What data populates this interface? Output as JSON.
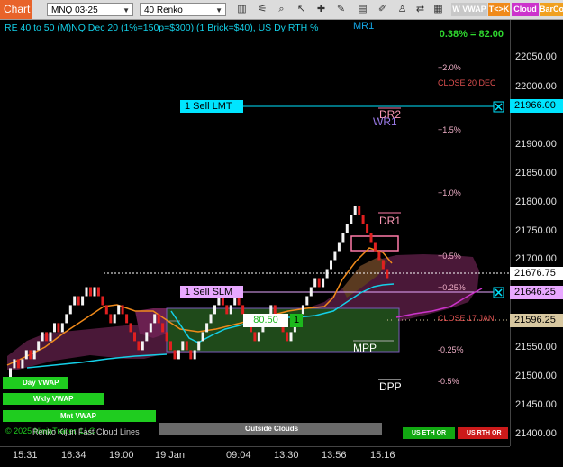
{
  "toolbar": {
    "tab": "Chart",
    "instrument": "MNQ 03-25",
    "bar_type": "40 Renko",
    "btn_wvwap": "W VWAP",
    "btn_tk": "T<>K",
    "btn_cloud": "Cloud",
    "btn_barco": "BarCo",
    "colors": {
      "tab": "#e8632a",
      "wvwap": "#c8c8c8",
      "tk": "#f08a1a",
      "cloud": "#cc33cc",
      "barco": "#f0a020"
    }
  },
  "chart_title": "RE 40 to 50 (M)NQ Dec 20 (1%=150p=$300) (1 Brick=$40), US Dy RTH %",
  "top_stat": "0.38% = 82.00",
  "level_labels": {
    "mr1": "MR1",
    "dr2": "DR2",
    "wr1": "WR1",
    "dr1": "DR1",
    "mpp": "MPP",
    "dpp": "DPP",
    "p2": "+2.0%",
    "close_dec": "CLOSE 20 DEC",
    "p15": "+1.5%",
    "p10": "+1.0%",
    "p05": "+0.5%",
    "p025": "+0.25%",
    "close_jan": "CLOSE 17 JAN",
    "m025": "-0.25%",
    "m05": "-0.5%"
  },
  "orders": {
    "sell_lmt": "1 Sell LMT",
    "sell_slm": "1 Sell SLM",
    "position_price": "80.50",
    "position_qty": "1"
  },
  "price_axis": {
    "ticks": [
      "22050.00",
      "22000.00",
      "21900.00",
      "21850.00",
      "21800.00",
      "21750.00",
      "21700.00",
      "21550.00",
      "21500.00",
      "21450.00",
      "21400.00"
    ],
    "tag_lmt": "21966.00",
    "tag_last": "21676.75",
    "tag_slm": "21646.25",
    "tag_close": "21596.25",
    "colors": {
      "lmt": "#00e5ff",
      "last": "#ffffff",
      "slm": "#e8a8ff",
      "close": "#d8c8a0"
    }
  },
  "time_axis": [
    "15:31",
    "16:34",
    "19:00",
    "19 Jan",
    "09:04",
    "13:30",
    "13:56",
    "15:16"
  ],
  "legend": {
    "day_vwap": "Day VWAP",
    "wkly_vwap": "Wkly VWAP",
    "mnt_vwap": "Mnt VWAP",
    "copyright": "© 2025 NinjaTrader, LLC",
    "renko": "Renko Kijun Fast Cloud Lines",
    "outside_clouds": "Outside Clouds",
    "us_eth": "US ETH OR",
    "us_rth": "US RTH OR"
  },
  "chart_data": {
    "type": "renko-candlestick",
    "title": "RE 40 to 50 (M)NQ Dec 20 (1%=150p=$300) (1 Brick=$40), US Dy RTH %",
    "ylim": [
      21380,
      22090
    ],
    "x_ticks": [
      "15:31",
      "16:34",
      "19:00",
      "19 Jan",
      "09:04",
      "13:30",
      "13:56",
      "15:16"
    ],
    "brick_closes": [
      21510,
      21525,
      21510,
      21525,
      21540,
      21525,
      21540,
      21555,
      21570,
      21555,
      21570,
      21585,
      21570,
      21585,
      21600,
      21615,
      21630,
      21615,
      21630,
      21645,
      21630,
      21645,
      21630,
      21615,
      21600,
      21585,
      21600,
      21615,
      21600,
      21585,
      21570,
      21555,
      21540,
      21555,
      21570,
      21585,
      21600,
      21585,
      21570,
      21555,
      21540,
      21525,
      21540,
      21555,
      21540,
      21525,
      21540,
      21555,
      21570,
      21585,
      21600,
      21615,
      21630,
      21615,
      21600,
      21615,
      21630,
      21615,
      21600,
      21585,
      21570,
      21555,
      21570,
      21585,
      21600,
      21615,
      21600,
      21585,
      21570,
      21555,
      21570,
      21585,
      21600,
      21615,
      21630,
      21645,
      21660,
      21645,
      21660,
      21675,
      21690,
      21705,
      21720,
      21735,
      21750,
      21765,
      21780,
      21765,
      21750,
      21735,
      21720,
      21705,
      21690,
      21675,
      21660
    ],
    "reference_levels": [
      {
        "name": "1 Sell LMT",
        "value": 21966.0
      },
      {
        "name": "last",
        "value": 21676.75
      },
      {
        "name": "1 Sell SLM",
        "value": 21646.25
      },
      {
        "name": "CLOSE 17 JAN",
        "value": 21596.25
      }
    ],
    "grid": false
  }
}
